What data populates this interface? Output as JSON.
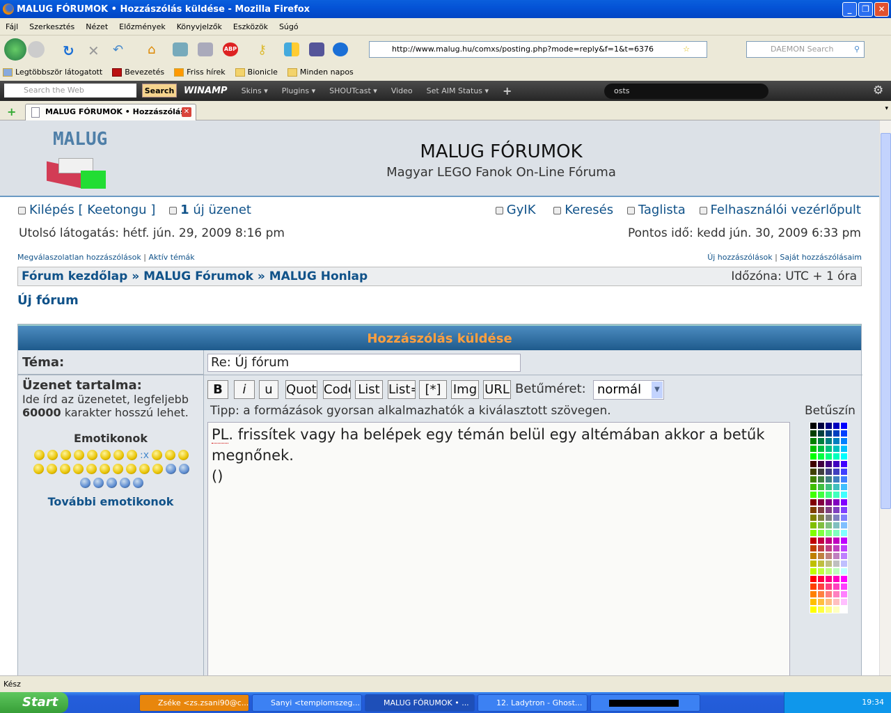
{
  "window": {
    "title": "MALUG FÓRUMOK • Hozzászólás küldése - Mozilla Firefox"
  },
  "menu": [
    "Fájl",
    "Szerkesztés",
    "Nézet",
    "Előzmények",
    "Könyvjelzők",
    "Eszközök",
    "Súgó"
  ],
  "navbar": {
    "url": "http://www.malug.hu/comxs/posting.php?mode=reply&f=1&t=6376",
    "search_placeholder": "DAEMON Search"
  },
  "bookmarks": [
    "Legtöbbször látogatott",
    "Bevezetés",
    "Friss hírek",
    "Bionicle",
    "Minden napos"
  ],
  "winamp": {
    "search_placeholder": "Search the Web",
    "search_button": "Search",
    "logo": "WINAMP",
    "items": [
      "Skins ▾",
      "Plugins ▾",
      "SHOUTcast ▾",
      "Video",
      "Set AIM Status ▾",
      "+"
    ],
    "ticker": "osts"
  },
  "tab": {
    "label": "MALUG FÓRUMOK • Hozzászólás ..."
  },
  "header": {
    "logo_text": "MALUG",
    "title": "MALUG FÓRUMOK",
    "description": "Magyar LEGO Fanok On-Line Fóruma"
  },
  "userbar": {
    "logout": "Kilépés [ Keetongu ]",
    "new_pm_count": "1",
    "new_pm_label": "új üzenet",
    "faq": "GyIK",
    "search": "Keresés",
    "members": "Taglista",
    "ucp": "Felhasználói vezérlőpult"
  },
  "times": {
    "last_visit": "Utolsó látogatás: hétf. jún. 29, 2009 8:16 pm",
    "current": "Pontos idő: kedd jún. 30, 2009 6:33 pm"
  },
  "quicklinks": {
    "unanswered": "Megválaszolatlan hozzászólások",
    "active": "Aktív témák",
    "new_posts": "Új hozzászólások",
    "own_posts": "Saját hozzászólásaim",
    "sep": "|"
  },
  "breadcrumb": {
    "items": [
      "Fórum kezdőlap",
      "MALUG Fórumok",
      "MALUG Honlap"
    ],
    "sep": "»",
    "timezone": "Időzóna: UTC + 1 óra"
  },
  "forum_name": "Új fórum",
  "post": {
    "heading": "Hozzászólás küldése",
    "subject_label": "Téma:",
    "subject_value": "Re: Új fórum",
    "message_label": "Üzenet tartalma:",
    "message_hint_1": "Ide írd az üzenetet, legfeljebb",
    "message_hint_limit": "60000",
    "message_hint_2": "karakter hosszú lehet.",
    "emoticons_label": "Emotikonok",
    "emoticon_text": ":x",
    "more_emoticons": "További emotikonok",
    "buttons": [
      "B",
      "i",
      "u",
      "Quote",
      "Code",
      "List",
      "List=",
      "[*]",
      "Img",
      "URL"
    ],
    "font_size_label": "Betűméret:",
    "font_size_value": "normál",
    "tip": "Tipp: a formázások gyorsan alkalmazhatók a kiválasztott szövegen.",
    "color_label": "Betűszín",
    "palette_steps": [
      "00",
      "40",
      "80",
      "BF",
      "FF"
    ],
    "message_line1_word": "PL",
    "message_line1_rest": ". frissítek vagy ha belépek egy témán belül egy altémában akkor a betűk",
    "message_line2": "megnőnek.",
    "message_line3": "()"
  },
  "status": {
    "text": "Kész"
  },
  "taskbar": {
    "start": "Start",
    "tasks": [
      "Zséke <zs.zsani90@c...",
      "Sanyi <templomszeg...",
      "MALUG FÓRUMOK • ...",
      "12. Ladytron - Ghost...",
      ""
    ],
    "clock": "19:34"
  }
}
